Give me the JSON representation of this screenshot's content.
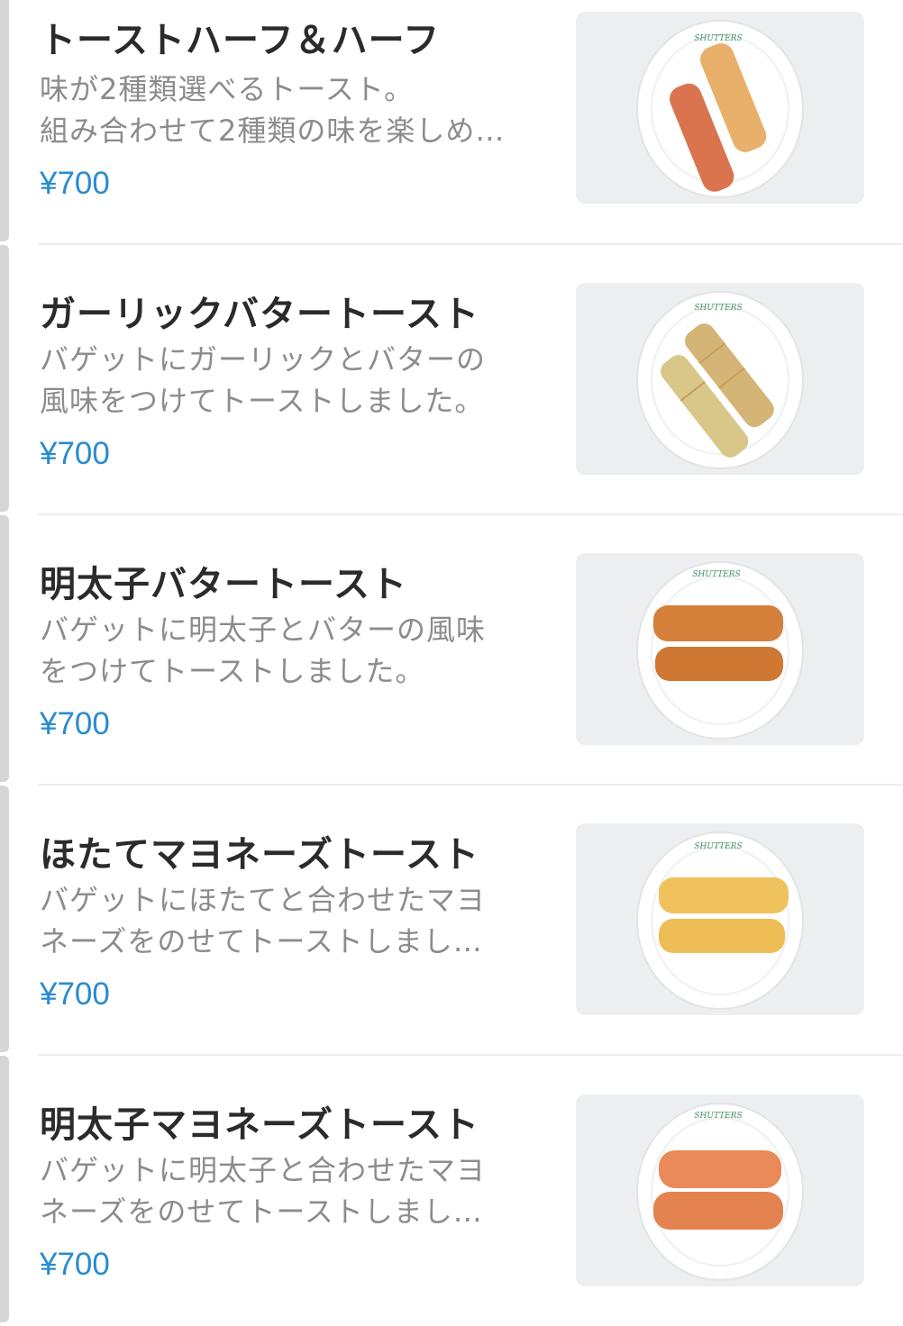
{
  "menu": {
    "items": [
      {
        "title": "トーストハーフ＆ハーフ",
        "desc_line1": "味が2種類選べるトースト。",
        "desc_line2": "組み合わせて2種類の味を楽しめ…",
        "price": "¥700",
        "plate_logo": "SHUTTERS",
        "bread_colors": [
          "#d9744f",
          "#e8b06a"
        ]
      },
      {
        "title": "ガーリックバタートースト",
        "desc_line1": "バゲットにガーリックとバターの",
        "desc_line2": "風味をつけてトーストしました。",
        "price": "¥700",
        "plate_logo": "SHUTTERS",
        "bread_colors": [
          "#d9c78a",
          "#d4b575"
        ]
      },
      {
        "title": "明太子バタートースト",
        "desc_line1": "バゲットに明太子とバターの風味",
        "desc_line2": "をつけてトーストしました。",
        "price": "¥700",
        "plate_logo": "SHUTTERS",
        "bread_colors": [
          "#d47f3a",
          "#cf7833"
        ]
      },
      {
        "title": "ほたてマヨネーズトースト",
        "desc_line1": "バゲットにほたてと合わせたマヨ",
        "desc_line2": "ネーズをのせてトーストしまし…",
        "price": "¥700",
        "plate_logo": "SHUTTERS",
        "bread_colors": [
          "#f0c25e",
          "#eebd55"
        ]
      },
      {
        "title": "明太子マヨネーズトースト",
        "desc_line1": "バゲットに明太子と合わせたマヨ",
        "desc_line2": "ネーズをのせてトーストしまし…",
        "price": "¥700",
        "plate_logo": "SHUTTERS",
        "bread_colors": [
          "#e98a58",
          "#e4834f"
        ]
      }
    ]
  },
  "colors": {
    "price": "#2a8bd0",
    "title": "#2b2b2b",
    "description": "#8c8c8c",
    "divider": "#ececec",
    "photo_bg": "#eceef0"
  }
}
